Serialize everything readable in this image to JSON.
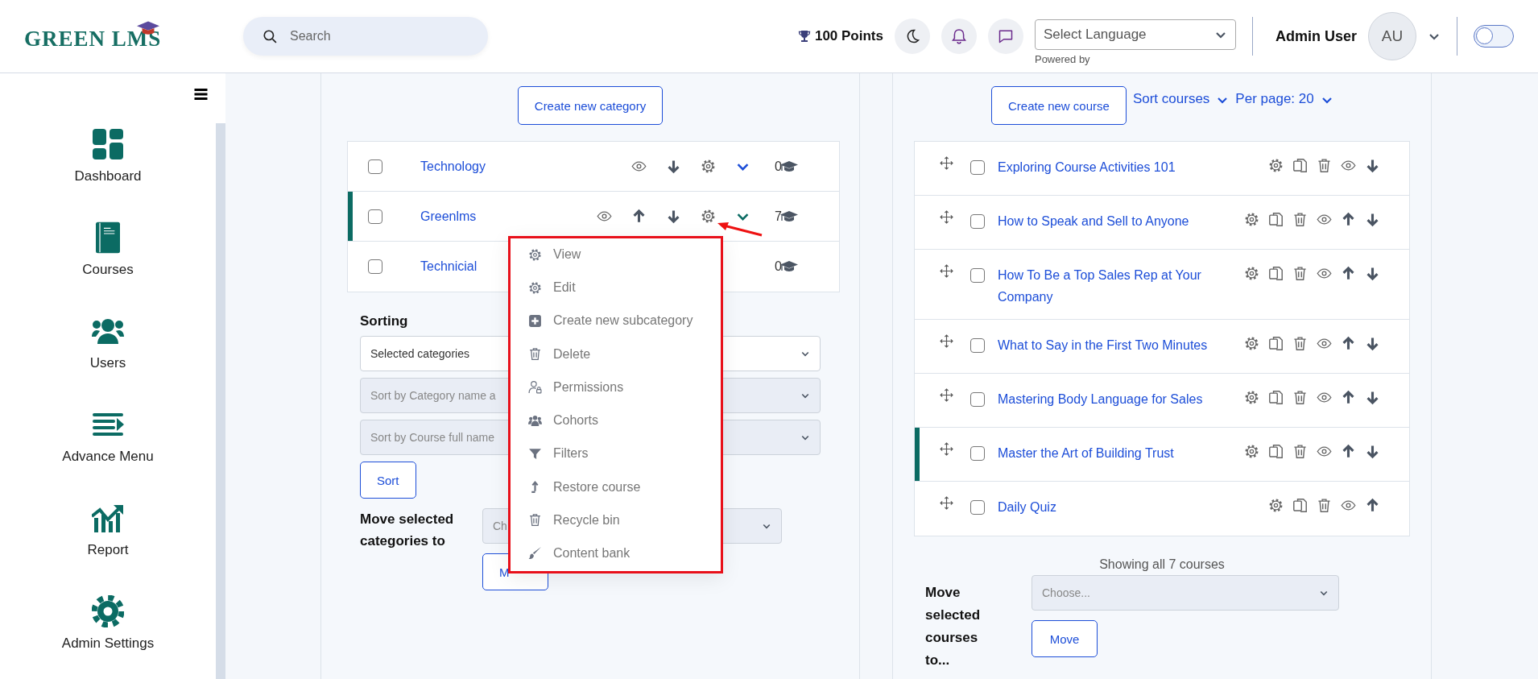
{
  "header": {
    "logo": "GREEN LMS",
    "search": {
      "placeholder": "Search"
    },
    "points": "100 Points",
    "language": {
      "value": "Select Language",
      "note": "Powered by"
    },
    "user": {
      "name": "Admin User",
      "initials": "AU"
    },
    "toggle": {
      "on": false
    }
  },
  "sidebar": {
    "items": [
      {
        "label": "Dashboard",
        "kind": "dashboard"
      },
      {
        "label": "Courses",
        "kind": "courses"
      },
      {
        "label": "Users",
        "kind": "users"
      },
      {
        "label": "Advance Menu",
        "kind": "menu"
      },
      {
        "label": "Report",
        "kind": "report"
      },
      {
        "label": "Admin Settings",
        "kind": "settings"
      }
    ]
  },
  "categories": {
    "create_button": "Create new category",
    "rows": [
      {
        "name": "Technology",
        "checked": false,
        "selected": false,
        "count": "0",
        "up": false,
        "down": true,
        "menu_open": false
      },
      {
        "name": "Greenlms",
        "checked": false,
        "selected": true,
        "count": "7",
        "up": true,
        "down": true,
        "menu_open": true
      },
      {
        "name": "Technicial",
        "checked": false,
        "selected": false,
        "count": "0"
      }
    ],
    "menu": [
      {
        "label": "View",
        "kind": "settings"
      },
      {
        "label": "Edit",
        "kind": "settings"
      },
      {
        "label": "Create new subcategory",
        "kind": "plus"
      },
      {
        "label": "Delete",
        "kind": "delete"
      },
      {
        "label": "Permissions",
        "kind": "permissions"
      },
      {
        "label": "Cohorts",
        "kind": "users"
      },
      {
        "label": "Filters",
        "kind": "filter"
      },
      {
        "label": "Restore course",
        "kind": "restore"
      },
      {
        "label": "Recycle bin",
        "kind": "delete"
      },
      {
        "label": "Content bank",
        "kind": "brush"
      }
    ],
    "sorting": {
      "label": "Sorting",
      "selects": [
        {
          "value": "Selected categories",
          "disabled": false
        },
        {
          "value": "Sort by Category name a",
          "disabled": true
        },
        {
          "value": "Sort by Course full name",
          "disabled": true
        }
      ],
      "button": "Sort"
    },
    "move": {
      "label": "Move selected categories to",
      "select": "Ch",
      "button": "M"
    }
  },
  "courses": {
    "create_button": "Create new course",
    "sort_link": "Sort courses",
    "per_page": "Per page: 20",
    "rows": [
      {
        "name": "Exploring Course Activities 101",
        "checked": false,
        "selected": false,
        "up": false,
        "down": true
      },
      {
        "name": "How to Speak and Sell to Anyone",
        "checked": false,
        "selected": false,
        "up": true,
        "down": true
      },
      {
        "name": "How To Be a Top Sales Rep at Your Company",
        "checked": false,
        "selected": false,
        "up": true,
        "down": true
      },
      {
        "name": "What to Say in the First Two Minutes",
        "checked": false,
        "selected": false,
        "up": true,
        "down": true
      },
      {
        "name": "Mastering Body Language for Sales",
        "checked": false,
        "selected": false,
        "up": true,
        "down": true
      },
      {
        "name": "Master the Art of Building Trust",
        "checked": false,
        "selected": true,
        "up": true,
        "down": true
      },
      {
        "name": "Daily Quiz",
        "checked": false,
        "selected": false,
        "up": true,
        "down": false
      }
    ],
    "summary": "Showing all 7 courses",
    "move": {
      "label": "Move selected courses to...",
      "select": "Choose...",
      "button": "Move"
    }
  }
}
